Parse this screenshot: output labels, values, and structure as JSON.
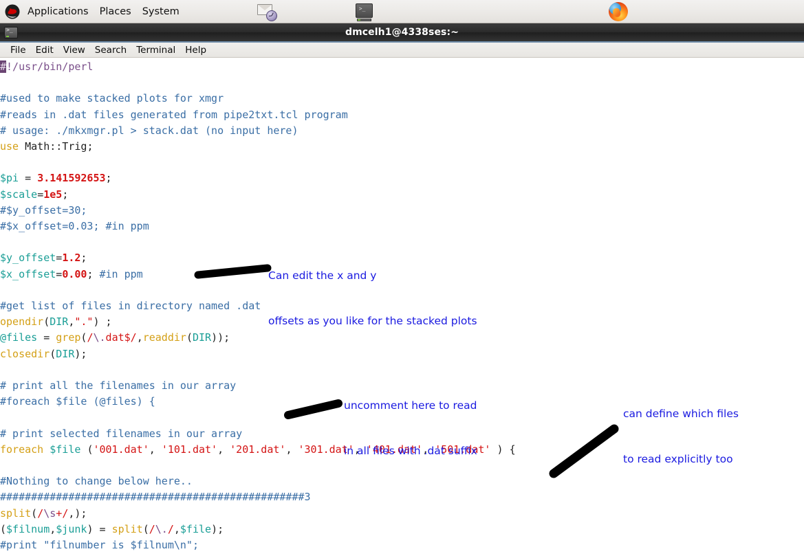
{
  "panel": {
    "logo_icon": "redhat-logo-icon",
    "menus": [
      {
        "label": "Applications",
        "name": "panel-menu-applications"
      },
      {
        "label": "Places",
        "name": "panel-menu-places"
      },
      {
        "label": "System",
        "name": "panel-menu-system"
      }
    ],
    "launchers": [
      {
        "icon": "mail-clock-icon",
        "name": "panel-launcher-evolution"
      },
      {
        "icon": "terminal-icon",
        "name": "panel-launcher-terminal"
      },
      {
        "icon": "firefox-icon",
        "name": "panel-launcher-firefox"
      }
    ]
  },
  "window": {
    "title": "dmcelh1@4338ses:~",
    "icon": "terminal-icon",
    "menubar": [
      {
        "label": "File",
        "name": "menu-file"
      },
      {
        "label": "Edit",
        "name": "menu-edit"
      },
      {
        "label": "View",
        "name": "menu-view"
      },
      {
        "label": "Search",
        "name": "menu-search"
      },
      {
        "label": "Terminal",
        "name": "menu-terminal"
      },
      {
        "label": "Help",
        "name": "menu-help"
      }
    ]
  },
  "code": {
    "language": "perl",
    "lines": [
      "#!/usr/bin/perl",
      "",
      "#used to make stacked plots for xmgr",
      "#reads in .dat files generated from pipe2txt.tcl program",
      "# usage: ./mkxmgr.pl > stack.dat (no input here)",
      "use Math::Trig;",
      "",
      "$pi = 3.141592653;",
      "$scale=1e5;",
      "#$y_offset=30;",
      "#$x_offset=0.03; #in ppm",
      "",
      "$y_offset=1.2;",
      "$x_offset=0.00; #in ppm",
      "",
      "#get list of files in directory named .dat",
      "opendir(DIR,\".\") ;",
      "@files = grep(/\\.dat$/,readdir(DIR));",
      "closedir(DIR);",
      "",
      "# print all the filenames in our array",
      "#foreach $file (@files) {",
      "",
      "# print selected filenames in our array",
      "foreach $file ('001.dat', '101.dat', '201.dat', '301.dat', '401.dat', '501.dat' ) {",
      "",
      "#Nothing to change below here..",
      "#################################################3",
      "split(/\\s+/,);",
      "($filnum,$junk) = split(/\\./,$file);",
      "#print \"filnumber is $filnum\\n\";"
    ],
    "cursor_char": "#",
    "cursor_line": 1,
    "cursor_column": 1
  },
  "annotations": [
    {
      "name": "annotation-offsets",
      "line1": "Can edit the x and y",
      "line2": "offsets as you like for the stacked plots"
    },
    {
      "name": "annotation-uncomment",
      "line1": "uncomment here to read",
      "line2": "in all files with .dat suffix"
    },
    {
      "name": "annotation-explicit-files",
      "line1": "can define which files",
      "line2": "to read explicitly too"
    }
  ],
  "colors": {
    "annotation_text": "#1a1ae0",
    "annotation_arrow": "#000000",
    "comment": "#3a6ea5",
    "keyword": "#d4a017",
    "variable": "#1a9e96",
    "number": "#d41414",
    "string": "#d41414",
    "shebang": "#7a4f8a",
    "cursor": "#6b4573",
    "titlebar": "#2b2b2b",
    "panel": "#eceae7",
    "terminal_bg": "#ffffff"
  }
}
